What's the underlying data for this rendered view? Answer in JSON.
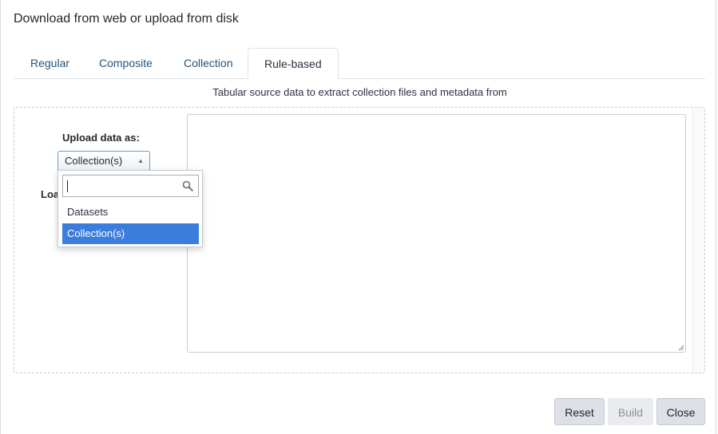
{
  "modal": {
    "title": "Download from web or upload from disk"
  },
  "tabs": [
    {
      "label": "Regular"
    },
    {
      "label": "Composite"
    },
    {
      "label": "Collection"
    },
    {
      "label": "Rule-based",
      "active": true
    }
  ],
  "subtitle": "Tabular source data to extract collection files and metadata from",
  "form": {
    "upload_label": "Upload data as:",
    "upload_select_value": "Collection(s)",
    "load_label_partial": "Loa",
    "dropdown": {
      "search_value": "",
      "options": [
        "Datasets",
        "Collection(s)"
      ],
      "selected": "Collection(s)"
    },
    "source_textarea_value": ""
  },
  "buttons": {
    "reset": "Reset",
    "build": "Build",
    "close": "Close"
  },
  "colors": {
    "link": "#25537b",
    "selected_option": "#3b7ddd",
    "button_bg": "#dde1e7"
  },
  "icons": {
    "search": "search-icon",
    "caret": "caret-up-icon",
    "resize": "resize-handle-icon"
  }
}
